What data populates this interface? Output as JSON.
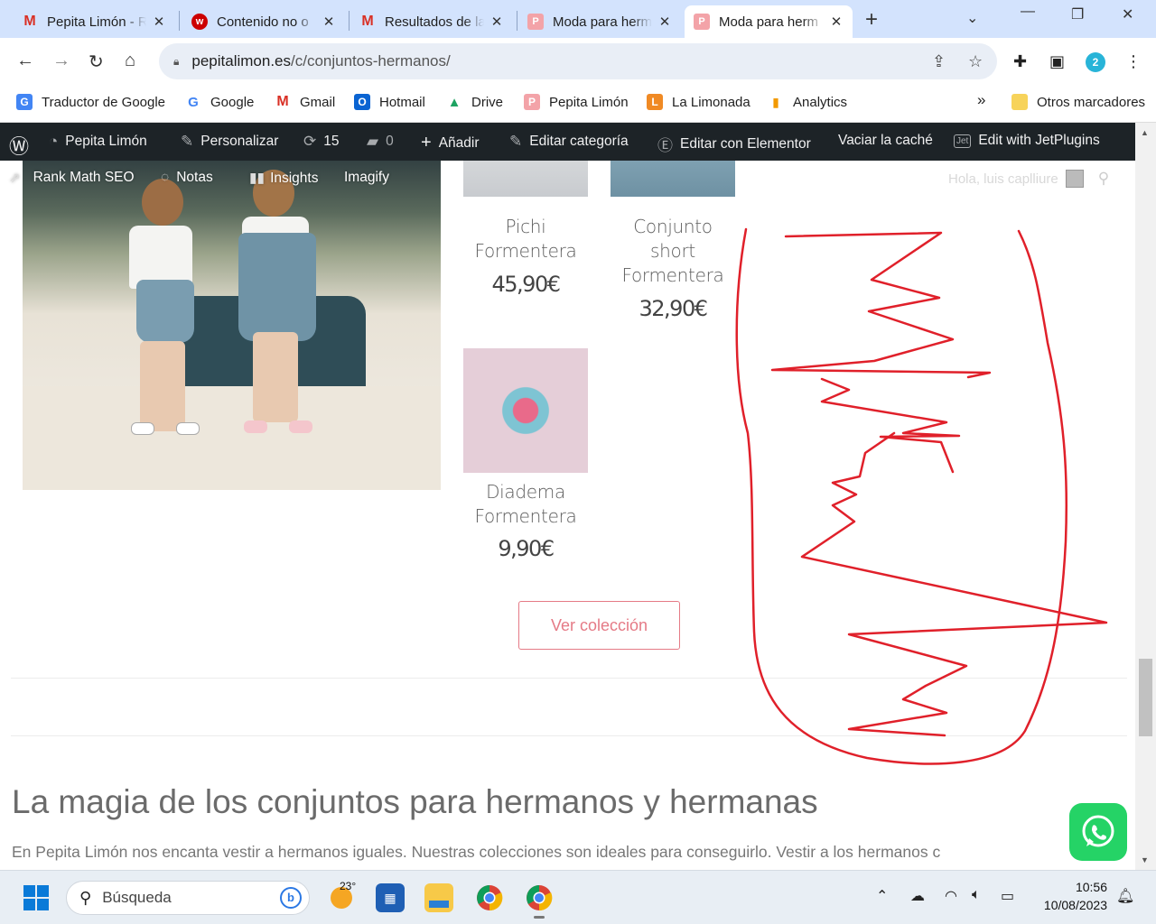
{
  "browser": {
    "tabs": [
      {
        "title": "Pepita Limón - R",
        "favicon": "gmail-icon",
        "active": false
      },
      {
        "title": "Contenido no o",
        "favicon": "w-icon",
        "active": false
      },
      {
        "title": "Resultados de la",
        "favicon": "gmail-icon",
        "active": false
      },
      {
        "title": "Moda para herm",
        "favicon": "pepita-icon",
        "active": false
      },
      {
        "title": "Moda para herm",
        "favicon": "pepita-icon",
        "active": true
      }
    ],
    "url_domain": "pepitalimon.es",
    "url_path": "/c/conjuntos-hermanos/",
    "profile_badge": "2",
    "bookmarks": [
      {
        "label": "Traductor de Google"
      },
      {
        "label": "Google"
      },
      {
        "label": "Gmail"
      },
      {
        "label": "Hotmail"
      },
      {
        "label": "Drive"
      },
      {
        "label": "Pepita Limón"
      },
      {
        "label": "La Limonada"
      },
      {
        "label": "Analytics"
      }
    ],
    "bookmarks_more": "»",
    "other_bookmarks": "Otros marcadores"
  },
  "wp_admin": {
    "site": "Pepita Limón",
    "customize": "Personalizar",
    "updates": "15",
    "comments": "0",
    "add": "Añadir",
    "edit_category": "Editar categoría",
    "elementor": "Editar con Elementor",
    "cache": "Vaciar la caché",
    "jet": "Edit with JetPlugins",
    "rank_math": "Rank Math SEO",
    "notes": "Notas",
    "insights": "Insights",
    "imagify": "Imagify",
    "greeting": "Hola, luis caplliure"
  },
  "products": [
    {
      "name_l1": "Pichi",
      "name_l2": "Formentera",
      "name_l3": "",
      "price": "45,90€"
    },
    {
      "name_l1": "Conjunto",
      "name_l2": "short",
      "name_l3": "Formentera",
      "price": "32,90€"
    },
    {
      "name_l1": "Diadema",
      "name_l2": "Formentera",
      "name_l3": "",
      "price": "9,90€"
    }
  ],
  "collection_button": "Ver colección",
  "heading": "La magia de los conjuntos para hermanos y hermanas",
  "intro": "En Pepita Limón nos encanta vestir a hermanos iguales. Nuestras colecciones son ideales para conseguirlo. Vestir a los hermanos c",
  "taskbar": {
    "search_placeholder": "Búsqueda",
    "weather": "23°",
    "time": "10:56",
    "date": "10/08/2023"
  },
  "colors": {
    "accent_pink": "#e57a86",
    "wp_bar": "#1d2327",
    "scribble_red": "#e0202a",
    "whatsapp": "#25d366"
  }
}
